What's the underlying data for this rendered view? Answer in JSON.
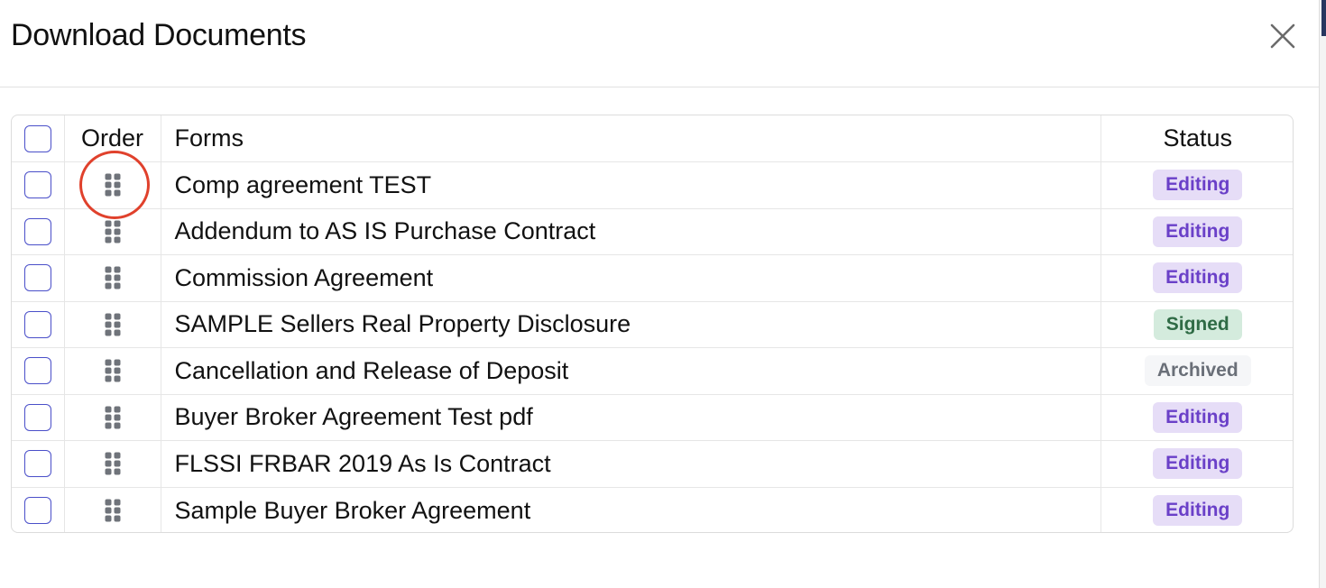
{
  "modal": {
    "title": "Download Documents"
  },
  "table": {
    "headers": {
      "order": "Order",
      "forms": "Forms",
      "status": "Status"
    },
    "rows": [
      {
        "form": "Comp agreement TEST",
        "status": "Editing",
        "status_kind": "editing"
      },
      {
        "form": "Addendum to AS IS Purchase Contract",
        "status": "Editing",
        "status_kind": "editing"
      },
      {
        "form": "Commission Agreement",
        "status": "Editing",
        "status_kind": "editing"
      },
      {
        "form": "SAMPLE Sellers Real Property Disclosure",
        "status": "Signed",
        "status_kind": "signed"
      },
      {
        "form": "Cancellation and Release of Deposit",
        "status": "Archived",
        "status_kind": "archived"
      },
      {
        "form": "Buyer Broker Agreement Test pdf",
        "status": "Editing",
        "status_kind": "editing"
      },
      {
        "form": "FLSSI FRBAR 2019 As Is Contract",
        "status": "Editing",
        "status_kind": "editing"
      },
      {
        "form": "Sample Buyer Broker Agreement",
        "status": "Editing",
        "status_kind": "editing"
      }
    ]
  },
  "icons": {
    "close": "close-icon",
    "drag": "drag-handle-icon"
  },
  "colors": {
    "checkbox_border": "#4a4fc9",
    "editing_bg": "#e6ddf7",
    "editing_text": "#6a40c8",
    "signed_bg": "#d4ebdd",
    "signed_text": "#2f6b45",
    "archived_bg": "#f5f6f8",
    "archived_text": "#6a6f78",
    "highlight_ring": "#e0412c"
  }
}
